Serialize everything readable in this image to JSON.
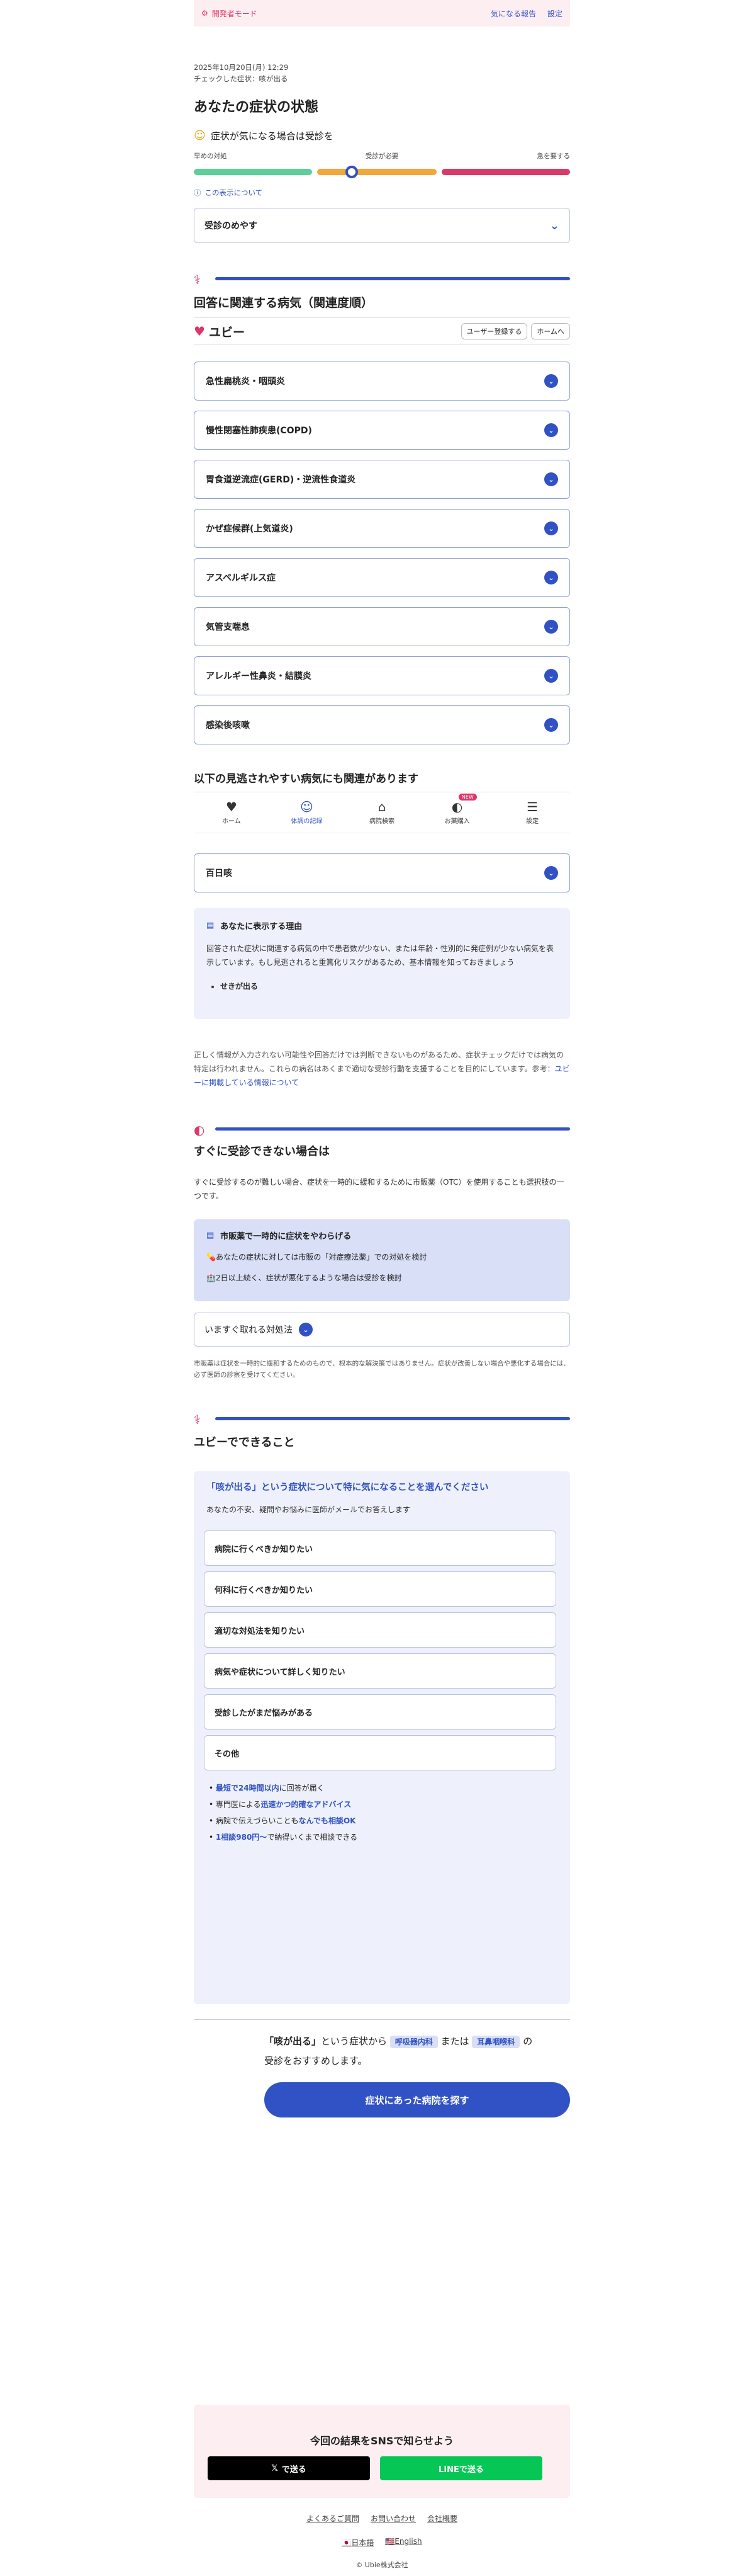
{
  "devbar": {
    "mode": "開発者モード",
    "link1": "気になる報告",
    "link2": "設定"
  },
  "meta": {
    "datetime": "2025年10月20日(月) 12:29",
    "checked": "チェックした症状：咳が出る"
  },
  "title": "あなたの症状の状態",
  "advice": "症状が気になる場合は受診を",
  "scale": {
    "left": "早めの対処",
    "middle": "受診が必要",
    "right": "急を要する",
    "level": 0.42
  },
  "hint": "この表示について",
  "guide_dropdown": "受診のめやす",
  "related": {
    "heading": "回答に関連する病気（関連度順）",
    "brand": "ユビー",
    "register_btn": "ユーザー登録する",
    "home_btn": "ホームへ",
    "diseases": [
      "急性扁桃炎・咽頭炎",
      "慢性閉塞性肺疾患(COPD)",
      "胃食道逆流症(GERD)・逆流性食道炎",
      "かぜ症候群(上気道炎)",
      "アスペルギルス症",
      "気管支喘息",
      "アレルギー性鼻炎・結膜炎",
      "感染後咳嗽"
    ]
  },
  "overlooked": {
    "heading": "以下の見逃されやすい病気にも関連があります",
    "disease": "百日咳"
  },
  "nav": {
    "items": [
      {
        "label": "ホーム",
        "icon": "heart-icon"
      },
      {
        "label": "体調の記録",
        "icon": "smile-icon"
      },
      {
        "label": "病院検索",
        "icon": "hospital-icon"
      },
      {
        "label": "お薬購入",
        "icon": "pill-icon",
        "badge": "NEW"
      },
      {
        "label": "設定",
        "icon": "sliders-icon"
      }
    ]
  },
  "reason": {
    "title": "あなたに表示する理由",
    "body": "回答された症状に関連する病気の中で患者数が少ない、または年齢・性別的に発症例が少ない病気を表示しています。もし見逃されると重篤化リスクがあるため、基本情報を知っておきましょう",
    "bullet": "せきが出る"
  },
  "disclaimer": {
    "text": "正しく情報が入力されない可能性や回答だけでは判断できないものがあるため、症状チェックだけでは病気の特定は行われません。これらの病名はあくまで適切な受診行動を支援することを目的にしています。参考：",
    "link": "ユビーに掲載している情報について"
  },
  "otc": {
    "heading": "すぐに受診できない場合は",
    "desc": "すぐに受診するのが難しい場合、症状を一時的に緩和するために市販薬（OTC）を使用することも選択肢の一つです。",
    "box_title": "市販薬で一時的に症状をやわらげる",
    "rows": [
      "あなたの症状に対しては市販の「対症療法薬」での対処を検討",
      "2日以上続く、症状が悪化するような場合は受診を検討"
    ],
    "dropdown": "いますぐ取れる対処法",
    "note": "市販薬は症状を一時的に緩和するためのもので、根本的な解決策ではありません。症状が改善しない場合や悪化する場合には、必ず医師の診察を受けてください。"
  },
  "ubie_can": {
    "heading": "ユビーでできること",
    "q_title": "「咳が出る」という症状について特に気になることを選んでください",
    "q_sub": "あなたの不安、疑問やお悩みに医師がメールでお答えします",
    "options": [
      "病院に行くべきか知りたい",
      "何科に行くべきか知りたい",
      "適切な対処法を知りたい",
      "病気や症状について詳しく知りたい",
      "受診したがまだ悩みがある",
      "その他"
    ],
    "bullets": [
      {
        "bold": "最短で24時間以内",
        "rest": "に回答が届く"
      },
      {
        "plain": "専門医による",
        "bold": "迅速かつ的確なアドバイス"
      },
      {
        "plain": "病院で伝えづらいことも",
        "bold": "なんでも相談OK"
      },
      {
        "bold": "1相談980円〜",
        "rest": "で納得いくまで相談できる"
      }
    ]
  },
  "recommend": {
    "pre": "「咳が出る」",
    "mid": "という症状から",
    "dept1": "呼吸器内科",
    "or": "または",
    "dept2": "耳鼻咽喉科",
    "post": "の",
    "line2": "受診をおすすめします。",
    "cta": "症状にあった病院を探す"
  },
  "sns": {
    "title": "今回の結果をSNSで知らせよう",
    "x": "で送る",
    "line": "LINEで送る"
  },
  "footer": {
    "faq": "よくあるご質問",
    "contact": "お問い合わせ",
    "company": "会社概要",
    "ja": "日本語",
    "en": "English",
    "copyright": "© Ubie株式会社"
  }
}
